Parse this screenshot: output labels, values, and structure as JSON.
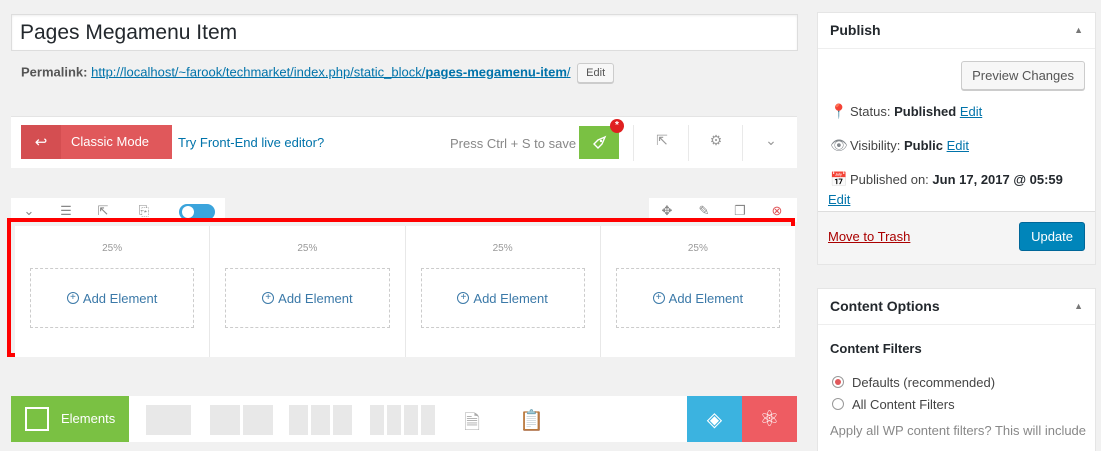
{
  "post": {
    "title": "Pages Megamenu Item",
    "permalink_label": "Permalink:",
    "permalink_base": "http://localhost/~farook/techmarket/index.php/static_block/",
    "permalink_slug": "pages-megamenu-item",
    "permalink_trail": "/",
    "permalink_edit": "Edit"
  },
  "vc_toolbar": {
    "classic_mode": "Classic Mode",
    "frontend_link": "Try Front-End live editor?",
    "save_hint": "Press Ctrl + S to save",
    "badge": "*"
  },
  "row": {
    "columns": [
      {
        "width": "25%",
        "add_label": "Add Element"
      },
      {
        "width": "25%",
        "add_label": "Add Element"
      },
      {
        "width": "25%",
        "add_label": "Add Element"
      },
      {
        "width": "25%",
        "add_label": "Add Element"
      }
    ]
  },
  "bottom_bar": {
    "elements_label": "Elements"
  },
  "publish": {
    "title": "Publish",
    "preview": "Preview Changes",
    "status_label": "Status: ",
    "status_value": "Published",
    "visibility_label": "Visibility: ",
    "visibility_value": "Public",
    "published_label": "Published on: ",
    "published_value": "Jun 17, 2017 @ 05:59",
    "edit": "Edit",
    "trash": "Move to Trash",
    "update": "Update"
  },
  "content_options": {
    "title": "Content Options",
    "filters_title": "Content Filters",
    "options": [
      "Defaults (recommended)",
      "All Content Filters"
    ],
    "selected": "Defaults (recommended)",
    "help": "Apply all WP content filters? This will include"
  },
  "colors": {
    "accent_green": "#7ac143",
    "classic_red": "#e0585b",
    "highlight": "#ff0000",
    "wp_blue": "#0085ba"
  }
}
